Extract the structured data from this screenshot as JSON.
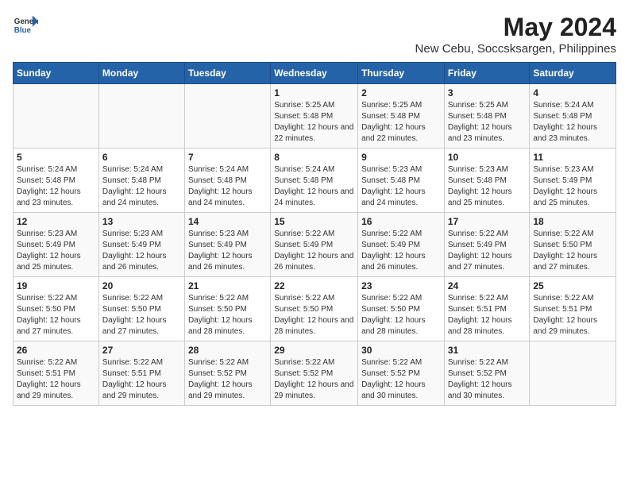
{
  "logo": {
    "line1": "General",
    "line2": "Blue"
  },
  "header": {
    "month_year": "May 2024",
    "location": "New Cebu, Soccsksargen, Philippines"
  },
  "days_of_week": [
    "Sunday",
    "Monday",
    "Tuesday",
    "Wednesday",
    "Thursday",
    "Friday",
    "Saturday"
  ],
  "weeks": [
    [
      {
        "day": "",
        "sunrise": "",
        "sunset": "",
        "daylight": ""
      },
      {
        "day": "",
        "sunrise": "",
        "sunset": "",
        "daylight": ""
      },
      {
        "day": "",
        "sunrise": "",
        "sunset": "",
        "daylight": ""
      },
      {
        "day": "1",
        "sunrise": "Sunrise: 5:25 AM",
        "sunset": "Sunset: 5:48 PM",
        "daylight": "Daylight: 12 hours and 22 minutes."
      },
      {
        "day": "2",
        "sunrise": "Sunrise: 5:25 AM",
        "sunset": "Sunset: 5:48 PM",
        "daylight": "Daylight: 12 hours and 22 minutes."
      },
      {
        "day": "3",
        "sunrise": "Sunrise: 5:25 AM",
        "sunset": "Sunset: 5:48 PM",
        "daylight": "Daylight: 12 hours and 23 minutes."
      },
      {
        "day": "4",
        "sunrise": "Sunrise: 5:24 AM",
        "sunset": "Sunset: 5:48 PM",
        "daylight": "Daylight: 12 hours and 23 minutes."
      }
    ],
    [
      {
        "day": "5",
        "sunrise": "Sunrise: 5:24 AM",
        "sunset": "Sunset: 5:48 PM",
        "daylight": "Daylight: 12 hours and 23 minutes."
      },
      {
        "day": "6",
        "sunrise": "Sunrise: 5:24 AM",
        "sunset": "Sunset: 5:48 PM",
        "daylight": "Daylight: 12 hours and 24 minutes."
      },
      {
        "day": "7",
        "sunrise": "Sunrise: 5:24 AM",
        "sunset": "Sunset: 5:48 PM",
        "daylight": "Daylight: 12 hours and 24 minutes."
      },
      {
        "day": "8",
        "sunrise": "Sunrise: 5:24 AM",
        "sunset": "Sunset: 5:48 PM",
        "daylight": "Daylight: 12 hours and 24 minutes."
      },
      {
        "day": "9",
        "sunrise": "Sunrise: 5:23 AM",
        "sunset": "Sunset: 5:48 PM",
        "daylight": "Daylight: 12 hours and 24 minutes."
      },
      {
        "day": "10",
        "sunrise": "Sunrise: 5:23 AM",
        "sunset": "Sunset: 5:48 PM",
        "daylight": "Daylight: 12 hours and 25 minutes."
      },
      {
        "day": "11",
        "sunrise": "Sunrise: 5:23 AM",
        "sunset": "Sunset: 5:49 PM",
        "daylight": "Daylight: 12 hours and 25 minutes."
      }
    ],
    [
      {
        "day": "12",
        "sunrise": "Sunrise: 5:23 AM",
        "sunset": "Sunset: 5:49 PM",
        "daylight": "Daylight: 12 hours and 25 minutes."
      },
      {
        "day": "13",
        "sunrise": "Sunrise: 5:23 AM",
        "sunset": "Sunset: 5:49 PM",
        "daylight": "Daylight: 12 hours and 26 minutes."
      },
      {
        "day": "14",
        "sunrise": "Sunrise: 5:23 AM",
        "sunset": "Sunset: 5:49 PM",
        "daylight": "Daylight: 12 hours and 26 minutes."
      },
      {
        "day": "15",
        "sunrise": "Sunrise: 5:22 AM",
        "sunset": "Sunset: 5:49 PM",
        "daylight": "Daylight: 12 hours and 26 minutes."
      },
      {
        "day": "16",
        "sunrise": "Sunrise: 5:22 AM",
        "sunset": "Sunset: 5:49 PM",
        "daylight": "Daylight: 12 hours and 26 minutes."
      },
      {
        "day": "17",
        "sunrise": "Sunrise: 5:22 AM",
        "sunset": "Sunset: 5:49 PM",
        "daylight": "Daylight: 12 hours and 27 minutes."
      },
      {
        "day": "18",
        "sunrise": "Sunrise: 5:22 AM",
        "sunset": "Sunset: 5:50 PM",
        "daylight": "Daylight: 12 hours and 27 minutes."
      }
    ],
    [
      {
        "day": "19",
        "sunrise": "Sunrise: 5:22 AM",
        "sunset": "Sunset: 5:50 PM",
        "daylight": "Daylight: 12 hours and 27 minutes."
      },
      {
        "day": "20",
        "sunrise": "Sunrise: 5:22 AM",
        "sunset": "Sunset: 5:50 PM",
        "daylight": "Daylight: 12 hours and 27 minutes."
      },
      {
        "day": "21",
        "sunrise": "Sunrise: 5:22 AM",
        "sunset": "Sunset: 5:50 PM",
        "daylight": "Daylight: 12 hours and 28 minutes."
      },
      {
        "day": "22",
        "sunrise": "Sunrise: 5:22 AM",
        "sunset": "Sunset: 5:50 PM",
        "daylight": "Daylight: 12 hours and 28 minutes."
      },
      {
        "day": "23",
        "sunrise": "Sunrise: 5:22 AM",
        "sunset": "Sunset: 5:50 PM",
        "daylight": "Daylight: 12 hours and 28 minutes."
      },
      {
        "day": "24",
        "sunrise": "Sunrise: 5:22 AM",
        "sunset": "Sunset: 5:51 PM",
        "daylight": "Daylight: 12 hours and 28 minutes."
      },
      {
        "day": "25",
        "sunrise": "Sunrise: 5:22 AM",
        "sunset": "Sunset: 5:51 PM",
        "daylight": "Daylight: 12 hours and 29 minutes."
      }
    ],
    [
      {
        "day": "26",
        "sunrise": "Sunrise: 5:22 AM",
        "sunset": "Sunset: 5:51 PM",
        "daylight": "Daylight: 12 hours and 29 minutes."
      },
      {
        "day": "27",
        "sunrise": "Sunrise: 5:22 AM",
        "sunset": "Sunset: 5:51 PM",
        "daylight": "Daylight: 12 hours and 29 minutes."
      },
      {
        "day": "28",
        "sunrise": "Sunrise: 5:22 AM",
        "sunset": "Sunset: 5:52 PM",
        "daylight": "Daylight: 12 hours and 29 minutes."
      },
      {
        "day": "29",
        "sunrise": "Sunrise: 5:22 AM",
        "sunset": "Sunset: 5:52 PM",
        "daylight": "Daylight: 12 hours and 29 minutes."
      },
      {
        "day": "30",
        "sunrise": "Sunrise: 5:22 AM",
        "sunset": "Sunset: 5:52 PM",
        "daylight": "Daylight: 12 hours and 30 minutes."
      },
      {
        "day": "31",
        "sunrise": "Sunrise: 5:22 AM",
        "sunset": "Sunset: 5:52 PM",
        "daylight": "Daylight: 12 hours and 30 minutes."
      },
      {
        "day": "",
        "sunrise": "",
        "sunset": "",
        "daylight": ""
      }
    ]
  ]
}
